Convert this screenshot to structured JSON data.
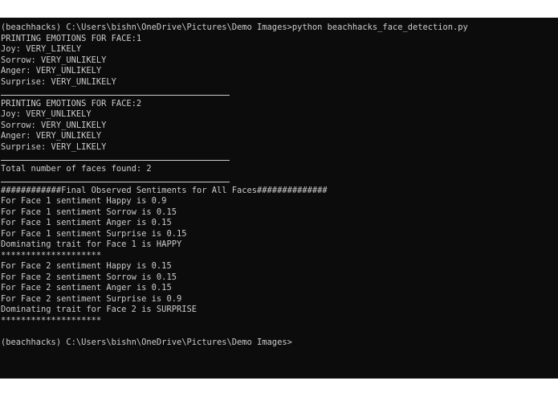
{
  "console": {
    "lines": [
      "(beachhacks) C:\\Users\\bishn\\OneDrive\\Pictures\\Demo Images>python beachhacks_face_detection.py",
      "PRINTING EMOTIONS FOR FACE:1",
      "Joy: VERY_LIKELY",
      "Sorrow: VERY_UNLIKELY",
      "Anger: VERY_UNLIKELY",
      "Surprise: VERY_UNLIKELY",
      "",
      "PRINTING EMOTIONS FOR FACE:2",
      "Joy: VERY_UNLIKELY",
      "Sorrow: VERY_UNLIKELY",
      "Anger: VERY_UNLIKELY",
      "Surprise: VERY_LIKELY",
      "",
      "Total number of faces found: 2",
      "",
      "############Final Observed Sentiments for All Faces##############",
      "For Face 1 sentiment Happy is 0.9",
      "For Face 1 sentiment Sorrow is 0.15",
      "For Face 1 sentiment Anger is 0.15",
      "For Face 1 sentiment Surprise is 0.15",
      "Dominating trait for Face 1 is HAPPY",
      "********************",
      "For Face 2 sentiment Happy is 0.15",
      "For Face 2 sentiment Sorrow is 0.15",
      "For Face 2 sentiment Anger is 0.15",
      "For Face 2 sentiment Surprise is 0.9",
      "Dominating trait for Face 2 is SURPRISE",
      "********************",
      "",
      "(beachhacks) C:\\Users\\bishn\\OneDrive\\Pictures\\Demo Images>"
    ]
  }
}
